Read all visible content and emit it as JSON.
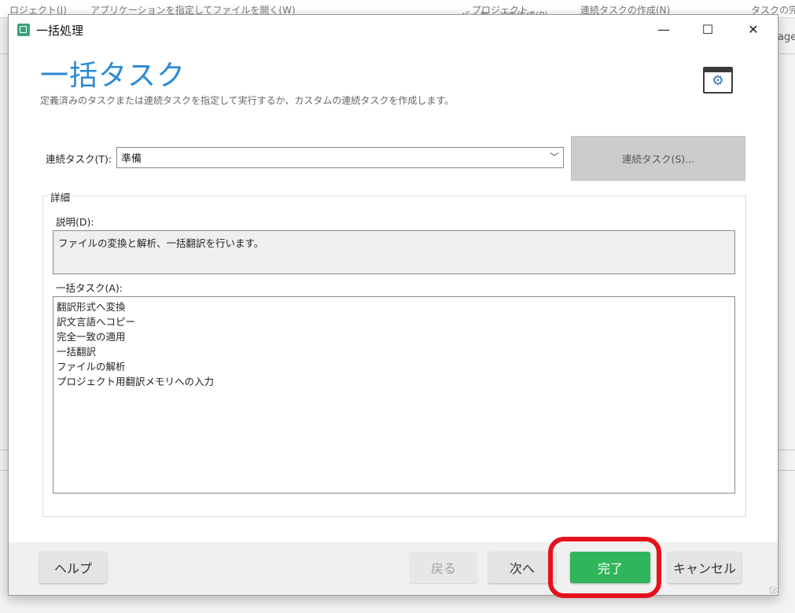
{
  "background_app": {
    "toolbar_items": [
      "ロジェクト(J)",
      "アプリケーションを指定してファイルを開く(W)",
      "プロジェクト",
      "連続タスクの作成(N)",
      "パッケージの作成(P)",
      "タスクの完"
    ],
    "right_edge_text": "age"
  },
  "window": {
    "title": "一括処理",
    "controls": {
      "minimize": "—",
      "maximize": "☐",
      "close": "✕"
    }
  },
  "page": {
    "heading": "一括タスク",
    "subheading": "定義済みのタスクまたは連続タスクを指定して実行するか、カスタムの連続タスクを作成します。"
  },
  "sequence": {
    "label": "連続タスク(T):",
    "selected": "準備",
    "button": "連続タスク(S)..."
  },
  "details": {
    "group_title": "詳細",
    "description_label": "説明(D):",
    "description_text": "ファイルの変換と解析、一括翻訳を行います。",
    "tasks_label": "一括タスク(A):",
    "tasks": [
      "翻訳形式へ変換",
      "訳文言語へコピー",
      "完全一致の適用",
      "一括翻訳",
      "ファイルの解析",
      "プロジェクト用翻訳メモリへの入力"
    ]
  },
  "footer": {
    "help": "ヘルプ",
    "back": "戻る",
    "next": "次へ",
    "finish": "完了",
    "cancel": "キャンセル"
  },
  "colors": {
    "heading": "#2b8ad6",
    "finish_button": "#2fb55a",
    "highlight": "#e5121b"
  }
}
